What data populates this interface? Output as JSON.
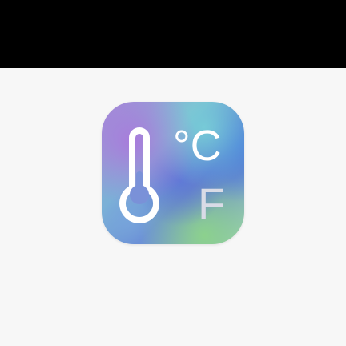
{
  "screen": {
    "top_bar_color": "#000000",
    "background_color": "#f7f7f7"
  },
  "app_icon": {
    "icon_name": "thermometer-temperature-converter-icon",
    "celsius_label": "°C",
    "fahrenheit_label": "F",
    "glyph_colors": {
      "thermometer": "#ffffff",
      "celsius": "#ffffff",
      "fahrenheit": "#d9dbe6",
      "fill": "#7a91d8"
    }
  }
}
